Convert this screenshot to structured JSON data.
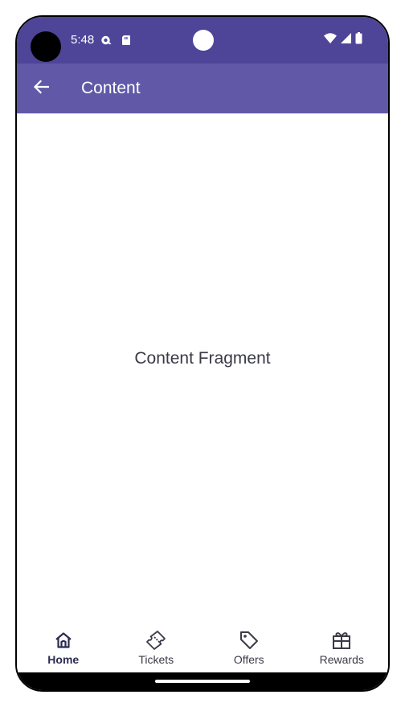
{
  "status_bar": {
    "time": "5:48",
    "icons_left": [
      "sync-icon",
      "sd-card-icon"
    ],
    "icons_right": [
      "wifi-icon",
      "cellular-signal-icon",
      "battery-icon"
    ]
  },
  "app_bar": {
    "title": "Content",
    "back_icon": "arrow-left-icon"
  },
  "content": {
    "text": "Content Fragment"
  },
  "bottom_nav": {
    "items": [
      {
        "label": "Home",
        "icon": "home-icon",
        "active": true
      },
      {
        "label": "Tickets",
        "icon": "ticket-icon",
        "active": false
      },
      {
        "label": "Offers",
        "icon": "tag-icon",
        "active": false
      },
      {
        "label": "Rewards",
        "icon": "gift-icon",
        "active": false
      }
    ]
  },
  "colors": {
    "status_bar": "#4e4598",
    "app_bar": "#6159a8",
    "text_dark": "#3a3a48",
    "nav_active": "#2b2b52"
  }
}
